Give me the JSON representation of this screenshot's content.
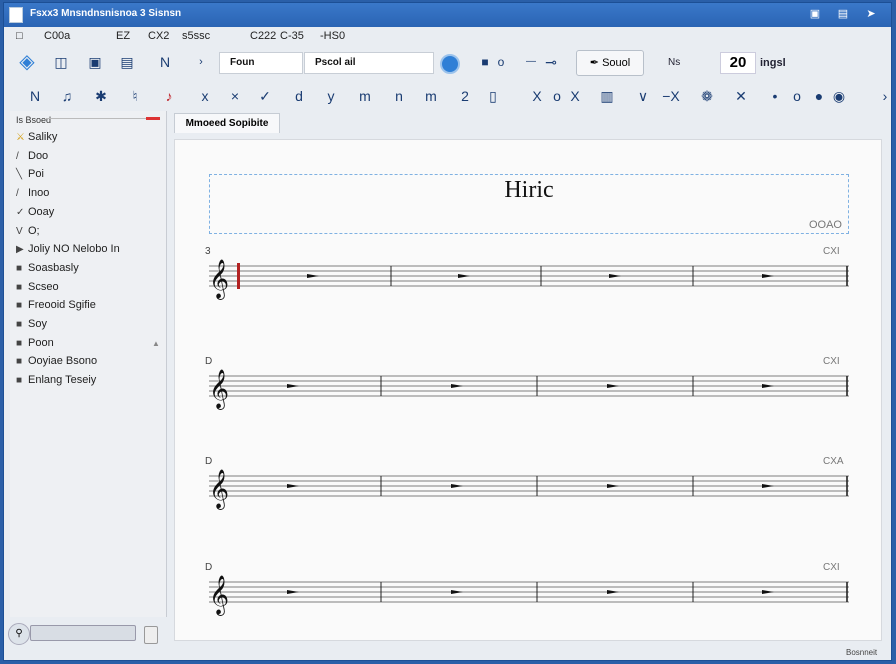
{
  "window": {
    "title": "Fsxx3 Mnsndnsnisnoa 3 Sisnsn",
    "controls": [
      "minimize",
      "maximize",
      "close"
    ]
  },
  "menu": [
    "C00a",
    "EZ",
    "CX2",
    "s5ssc",
    "C222",
    "C-35",
    "-HS0"
  ],
  "toolbar": {
    "row1_icons": [
      "diamond-icon",
      "layout-icon",
      "window-icon",
      "panel-icon",
      "note-input-icon",
      "arrow-icon"
    ],
    "font_combo": "Foun",
    "style_combo": "Pscol ail",
    "zoom_label": "Souol",
    "tempo_text": "Ns",
    "number_value": "20",
    "number_unit": "ingsl",
    "row2_symbols": [
      "N",
      "♫",
      "✱",
      "♮",
      "♪",
      "x",
      "×",
      "✓",
      "d",
      "y",
      "m",
      "n",
      "m",
      "2",
      "▯",
      "X",
      "o",
      "X",
      "▥",
      "∨",
      "−X",
      "❁",
      "✕",
      "•",
      "o",
      "●",
      "◉",
      "›"
    ]
  },
  "sidebar": {
    "header": "Is Bsoed",
    "items": [
      {
        "icon": "⚔",
        "label": "Saliky"
      },
      {
        "icon": "/",
        "label": "Doo"
      },
      {
        "icon": "╲",
        "label": "Poi"
      },
      {
        "icon": "/",
        "label": "Inoo"
      },
      {
        "icon": "✓",
        "label": "Ooay"
      },
      {
        "icon": "V",
        "label": "O;"
      },
      {
        "icon": "▶",
        "label": "Joliy NO Nelobo In"
      },
      {
        "icon": "■",
        "label": "Soasbasly"
      },
      {
        "icon": "■",
        "label": "Scseo"
      },
      {
        "icon": "■",
        "label": "Freooid Sgifie"
      },
      {
        "icon": "■",
        "label": "Soy"
      },
      {
        "icon": "■",
        "label": "Poon"
      },
      {
        "icon": "■",
        "label": "Ooyiae Bsono"
      },
      {
        "icon": "■",
        "label": "Enlang Teseiy"
      }
    ]
  },
  "tabs": [
    {
      "label": "Mmoeed Sopibite"
    }
  ],
  "score": {
    "title": "Hiric",
    "composer": "OOAO",
    "systems": [
      {
        "num": "3",
        "label": "CXI"
      },
      {
        "num": "D",
        "label": "CXI"
      },
      {
        "num": "D",
        "label": "CXA"
      },
      {
        "num": "D",
        "label": "CXI"
      }
    ]
  },
  "status": {
    "right": "Bosnneit"
  },
  "colors": {
    "titlebar": "#2a64b4",
    "accent_blue": "#2f7fd6",
    "cursor_red": "#b22222"
  }
}
